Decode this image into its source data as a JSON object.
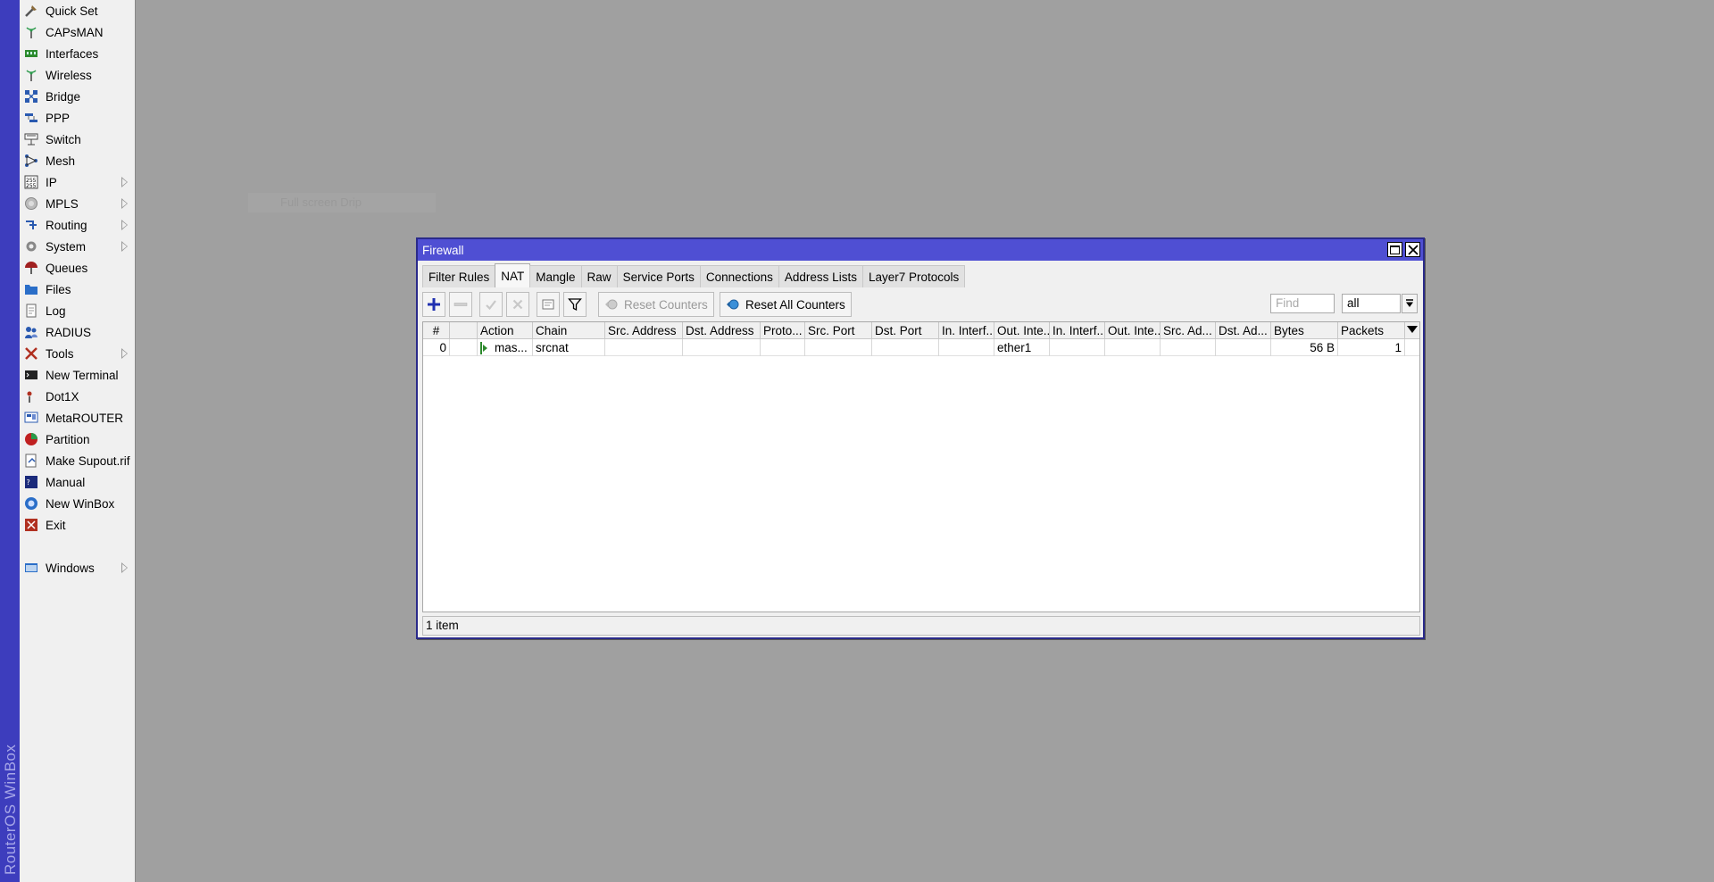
{
  "sidebar_brand": "RouterOS WinBox",
  "menu": [
    {
      "label": "Quick Set",
      "icon": "quick-set-icon",
      "submenu": false
    },
    {
      "label": "CAPsMAN",
      "icon": "capsman-antenna-icon",
      "submenu": false
    },
    {
      "label": "Interfaces",
      "icon": "interfaces-icon",
      "submenu": false
    },
    {
      "label": "Wireless",
      "icon": "wireless-antenna-icon",
      "submenu": false
    },
    {
      "label": "Bridge",
      "icon": "bridge-icon",
      "submenu": false
    },
    {
      "label": "PPP",
      "icon": "ppp-icon",
      "submenu": false
    },
    {
      "label": "Switch",
      "icon": "switch-icon",
      "submenu": false
    },
    {
      "label": "Mesh",
      "icon": "mesh-icon",
      "submenu": false
    },
    {
      "label": "IP",
      "icon": "ip-icon",
      "submenu": true
    },
    {
      "label": "MPLS",
      "icon": "mpls-icon",
      "submenu": true
    },
    {
      "label": "Routing",
      "icon": "routing-icon",
      "submenu": true
    },
    {
      "label": "System",
      "icon": "system-gear-icon",
      "submenu": true
    },
    {
      "label": "Queues",
      "icon": "queues-icon",
      "submenu": false
    },
    {
      "label": "Files",
      "icon": "folder-icon",
      "submenu": false
    },
    {
      "label": "Log",
      "icon": "log-icon",
      "submenu": false
    },
    {
      "label": "RADIUS",
      "icon": "radius-icon",
      "submenu": false
    },
    {
      "label": "Tools",
      "icon": "tools-icon",
      "submenu": true
    },
    {
      "label": "New Terminal",
      "icon": "terminal-icon",
      "submenu": false
    },
    {
      "label": "Dot1X",
      "icon": "dot1x-icon",
      "submenu": false
    },
    {
      "label": "MetaROUTER",
      "icon": "metarouter-icon",
      "submenu": false
    },
    {
      "label": "Partition",
      "icon": "partition-icon",
      "submenu": false
    },
    {
      "label": "Make Supout.rif",
      "icon": "supout-icon",
      "submenu": false
    },
    {
      "label": "Manual",
      "icon": "manual-icon",
      "submenu": false
    },
    {
      "label": "New WinBox",
      "icon": "winbox-icon",
      "submenu": false
    },
    {
      "label": "Exit",
      "icon": "exit-icon",
      "submenu": false
    },
    {
      "label": "Windows",
      "icon": "windows-icon",
      "submenu": true
    }
  ],
  "desktop_note": "Full screen Drip",
  "firewall": {
    "title": "Firewall",
    "tabs": [
      "Filter Rules",
      "NAT",
      "Mangle",
      "Raw",
      "Service Ports",
      "Connections",
      "Address Lists",
      "Layer7 Protocols"
    ],
    "active_tab": "NAT",
    "toolbar": {
      "reset_counters": "Reset Counters",
      "reset_all_counters": "Reset All Counters",
      "find_placeholder": "Find",
      "filter_value": "all"
    },
    "columns": [
      "#",
      "",
      "Action",
      "Chain",
      "Src. Address",
      "Dst. Address",
      "Proto...",
      "Src. Port",
      "Dst. Port",
      "In. Interf...",
      "Out. Inte...",
      "In. Interf...",
      "Out. Inte...",
      "Src. Ad...",
      "Dst. Ad...",
      "Bytes",
      "Packets"
    ],
    "rows": [
      {
        "num": "0",
        "flag": "",
        "action": "mas...",
        "chain": "srcnat",
        "src_address": "",
        "dst_address": "",
        "protocol": "",
        "src_port": "",
        "dst_port": "",
        "in_interface": "",
        "out_interface": "ether1",
        "in_interface_list": "",
        "out_interface_list": "",
        "src_address_list": "",
        "dst_address_list": "",
        "bytes": "56 B",
        "packets": "1"
      }
    ],
    "status": "1 item"
  }
}
